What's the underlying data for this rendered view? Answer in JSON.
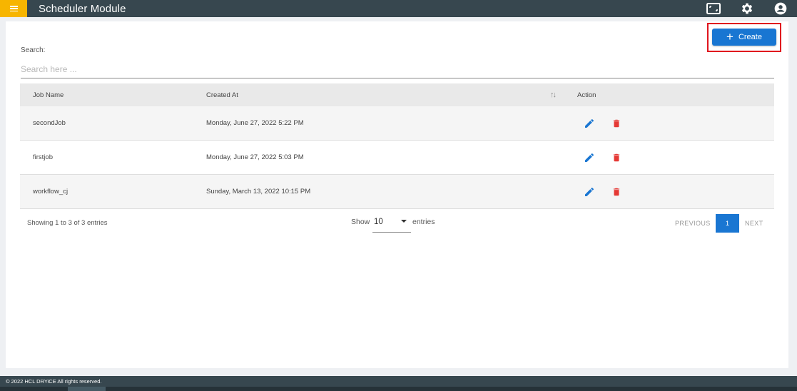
{
  "header": {
    "title": "Scheduler Module"
  },
  "icons": {
    "menu": "hamburger-icon",
    "screen": "screen-capture-icon",
    "settings": "gear-icon",
    "user": "user-account-icon",
    "plus": "plus-icon",
    "edit": "pencil-icon",
    "delete": "trash-icon",
    "sort": "sort-icon"
  },
  "colors": {
    "topbar": "#37474f",
    "menu_accent": "#f7b500",
    "primary": "#1976d2",
    "delete": "#e53935",
    "highlight": "#e0141e"
  },
  "toolbar": {
    "create_label": "Create",
    "plus_glyph": "+"
  },
  "search": {
    "label": "Search:",
    "placeholder": "Search here ...",
    "value": ""
  },
  "table": {
    "columns": {
      "job_name": "Job Name",
      "created_at": "Created At",
      "sort": "↑↓",
      "action": "Action"
    },
    "rows": [
      {
        "job_name": "secondJob",
        "created_at": "Monday, June 27, 2022 5:22 PM"
      },
      {
        "job_name": "firstjob",
        "created_at": "Monday, June 27, 2022 5:03 PM"
      },
      {
        "job_name": "workflow_cj",
        "created_at": "Sunday, March 13, 2022 10:15 PM"
      }
    ]
  },
  "pagination": {
    "showing": "Showing 1 to 3 of 3 entries",
    "show_label": "Show",
    "page_size": "10",
    "entries_label": "entries",
    "previous": "PREVIOUS",
    "current_page": "1",
    "next": "NEXT"
  },
  "footer": {
    "copyright": "© 2022 HCL DRYiCE All rights reserved."
  }
}
